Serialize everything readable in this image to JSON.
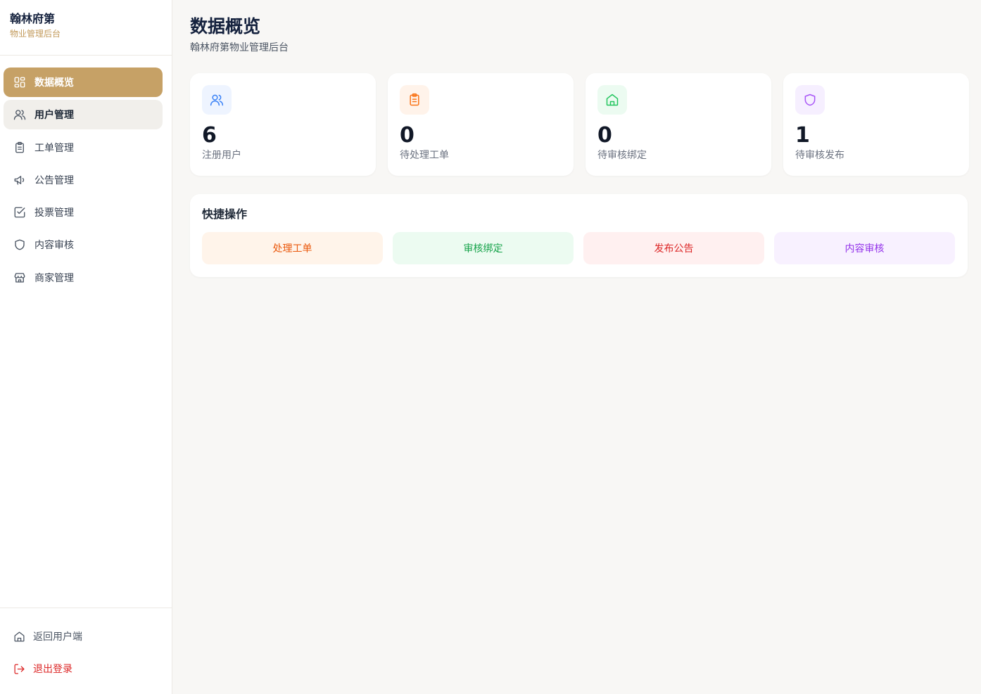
{
  "sidebar": {
    "brand_name": "翰林府第",
    "brand_sub": "物业管理后台",
    "items": [
      {
        "label": "数据概览",
        "icon": "dashboard-icon"
      },
      {
        "label": "用户管理",
        "icon": "users-icon"
      },
      {
        "label": "工单管理",
        "icon": "clipboard-icon"
      },
      {
        "label": "公告管理",
        "icon": "megaphone-icon"
      },
      {
        "label": "投票管理",
        "icon": "checkbox-icon"
      },
      {
        "label": "内容审核",
        "icon": "shield-icon"
      },
      {
        "label": "商家管理",
        "icon": "store-icon"
      }
    ],
    "bottom": {
      "back_label": "返回用户端",
      "logout_label": "退出登录"
    }
  },
  "header": {
    "title": "数据概览",
    "subtitle": "翰林府第物业管理后台"
  },
  "stats": [
    {
      "value": "6",
      "label": "注册用户",
      "icon": "users-icon",
      "color": "#3b82f6",
      "bg": "#eef4ff"
    },
    {
      "value": "0",
      "label": "待处理工单",
      "icon": "clipboard-icon",
      "color": "#f97316",
      "bg": "#fff3ea"
    },
    {
      "value": "0",
      "label": "待审核绑定",
      "icon": "home-icon",
      "color": "#22c55e",
      "bg": "#ecfbf1"
    },
    {
      "value": "1",
      "label": "待审核发布",
      "icon": "shield-icon",
      "color": "#a855f7",
      "bg": "#f6efff"
    }
  ],
  "quick": {
    "title": "快捷操作",
    "buttons": [
      {
        "label": "处理工单",
        "color": "#ea580c",
        "bg": "#fff4ea"
      },
      {
        "label": "审核绑定",
        "color": "#16a34a",
        "bg": "#ecfbf1"
      },
      {
        "label": "发布公告",
        "color": "#dc2626",
        "bg": "#fff0f0"
      },
      {
        "label": "内容审核",
        "color": "#9333ea",
        "bg": "#f8f1ff"
      }
    ]
  }
}
